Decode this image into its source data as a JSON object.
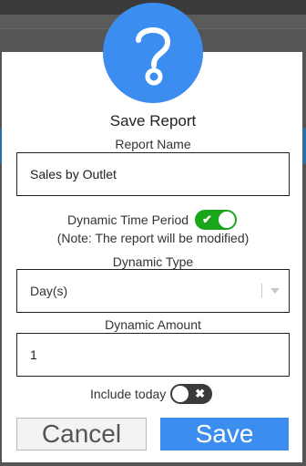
{
  "dialog": {
    "title": "Save Report",
    "report_name_label": "Report Name",
    "report_name_value": "Sales by Outlet",
    "dynamic_time_period_label": "Dynamic Time Period",
    "dynamic_time_period_note": "(Note: The report will be modified)",
    "dynamic_time_period_on": true,
    "dynamic_type_label": "Dynamic Type",
    "dynamic_type_value": "Day(s)",
    "dynamic_amount_label": "Dynamic Amount",
    "dynamic_amount_value": "1",
    "include_today_label": "Include today",
    "include_today_on": false,
    "cancel_label": "Cancel",
    "save_label": "Save"
  },
  "icons": {
    "badge": "question-mark-icon",
    "toggle_on": "check-icon",
    "toggle_off": "x-icon",
    "select": "chevron-down-icon"
  },
  "colors": {
    "accent": "#3b8ef0",
    "toggle_on": "#1aa51a",
    "toggle_off": "#3a3a3a"
  }
}
